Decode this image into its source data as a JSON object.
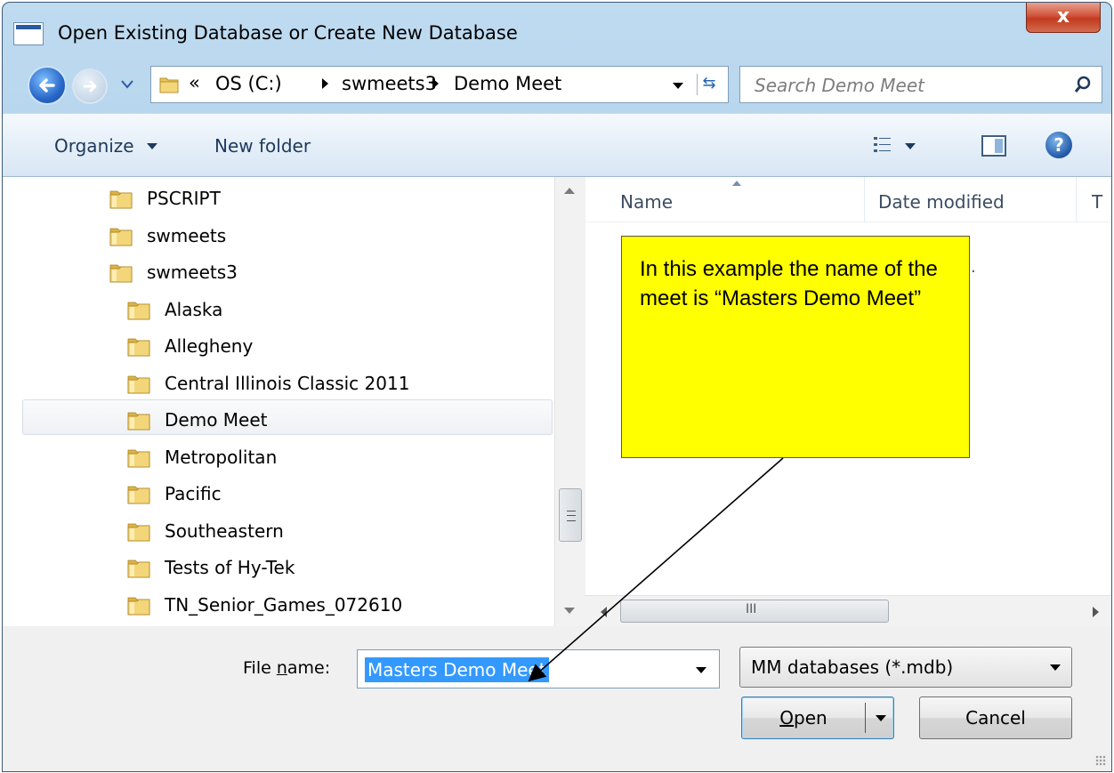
{
  "window": {
    "title": "Open Existing Database or Create New Database",
    "close_label": "x"
  },
  "address_bar": {
    "chevron": "«",
    "breadcrumbs": [
      "OS (C:)",
      "swmeets3",
      "Demo Meet"
    ]
  },
  "search": {
    "placeholder": "Search Demo Meet"
  },
  "toolbar": {
    "organize_label": "Organize",
    "new_folder_label": "New folder",
    "help_label": "?"
  },
  "nav_pane": {
    "items": [
      {
        "label": "PSCRIPT",
        "level": 1
      },
      {
        "label": "swmeets",
        "level": 1
      },
      {
        "label": "swmeets3",
        "level": 1
      },
      {
        "label": "Alaska",
        "level": 2
      },
      {
        "label": "Allegheny",
        "level": 2
      },
      {
        "label": "Central Illinois Classic 2011",
        "level": 2
      },
      {
        "label": "Demo Meet",
        "level": 2,
        "selected": true
      },
      {
        "label": "Metropolitan",
        "level": 2
      },
      {
        "label": "Pacific",
        "level": 2
      },
      {
        "label": "Southeastern",
        "level": 2
      },
      {
        "label": "Tests of Hy-Tek",
        "level": 2
      },
      {
        "label": "TN_Senior_Games_072610",
        "level": 2
      }
    ]
  },
  "file_list": {
    "columns": [
      "Name",
      "Date modified",
      "T"
    ],
    "scroll_thumb_glyph": "III"
  },
  "callout": {
    "text": "In this example the name of the meet is “Masters Demo Meet”"
  },
  "footer": {
    "file_name_label": "File name:",
    "file_name_value": "Masters Demo Meet",
    "file_type_value": "MM databases (*.mdb)",
    "open_label": "Open",
    "cancel_label": "Cancel"
  },
  "colors": {
    "callout_bg": "#ffff00",
    "selection_bg": "#3399ff",
    "close_button": "#c23a1e"
  }
}
